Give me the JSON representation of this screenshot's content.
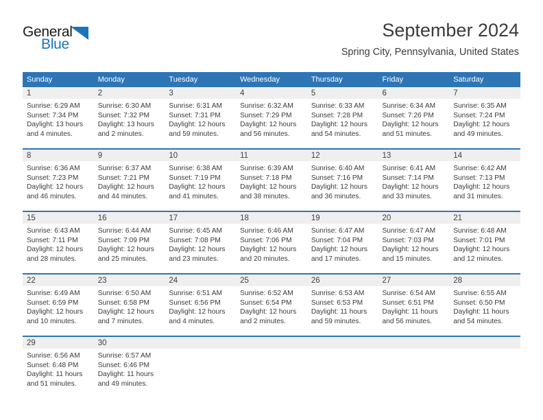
{
  "brand": {
    "name_part1": "General",
    "name_part2": "Blue",
    "triangle_color": "#1c73b8"
  },
  "header": {
    "title": "September 2024",
    "subtitle": "Spring City, Pennsylvania, United States"
  },
  "theme": {
    "header_bg": "#2e75b6",
    "daynum_bg": "#efefef",
    "text": "#3a3a3a"
  },
  "weekday_headers": [
    "Sunday",
    "Monday",
    "Tuesday",
    "Wednesday",
    "Thursday",
    "Friday",
    "Saturday"
  ],
  "weeks": [
    [
      {
        "day": "1",
        "sunrise": "Sunrise: 6:29 AM",
        "sunset": "Sunset: 7:34 PM",
        "daylight_line1": "Daylight: 13 hours",
        "daylight_line2": "and 4 minutes."
      },
      {
        "day": "2",
        "sunrise": "Sunrise: 6:30 AM",
        "sunset": "Sunset: 7:32 PM",
        "daylight_line1": "Daylight: 13 hours",
        "daylight_line2": "and 2 minutes."
      },
      {
        "day": "3",
        "sunrise": "Sunrise: 6:31 AM",
        "sunset": "Sunset: 7:31 PM",
        "daylight_line1": "Daylight: 12 hours",
        "daylight_line2": "and 59 minutes."
      },
      {
        "day": "4",
        "sunrise": "Sunrise: 6:32 AM",
        "sunset": "Sunset: 7:29 PM",
        "daylight_line1": "Daylight: 12 hours",
        "daylight_line2": "and 56 minutes."
      },
      {
        "day": "5",
        "sunrise": "Sunrise: 6:33 AM",
        "sunset": "Sunset: 7:28 PM",
        "daylight_line1": "Daylight: 12 hours",
        "daylight_line2": "and 54 minutes."
      },
      {
        "day": "6",
        "sunrise": "Sunrise: 6:34 AM",
        "sunset": "Sunset: 7:26 PM",
        "daylight_line1": "Daylight: 12 hours",
        "daylight_line2": "and 51 minutes."
      },
      {
        "day": "7",
        "sunrise": "Sunrise: 6:35 AM",
        "sunset": "Sunset: 7:24 PM",
        "daylight_line1": "Daylight: 12 hours",
        "daylight_line2": "and 49 minutes."
      }
    ],
    [
      {
        "day": "8",
        "sunrise": "Sunrise: 6:36 AM",
        "sunset": "Sunset: 7:23 PM",
        "daylight_line1": "Daylight: 12 hours",
        "daylight_line2": "and 46 minutes."
      },
      {
        "day": "9",
        "sunrise": "Sunrise: 6:37 AM",
        "sunset": "Sunset: 7:21 PM",
        "daylight_line1": "Daylight: 12 hours",
        "daylight_line2": "and 44 minutes."
      },
      {
        "day": "10",
        "sunrise": "Sunrise: 6:38 AM",
        "sunset": "Sunset: 7:19 PM",
        "daylight_line1": "Daylight: 12 hours",
        "daylight_line2": "and 41 minutes."
      },
      {
        "day": "11",
        "sunrise": "Sunrise: 6:39 AM",
        "sunset": "Sunset: 7:18 PM",
        "daylight_line1": "Daylight: 12 hours",
        "daylight_line2": "and 38 minutes."
      },
      {
        "day": "12",
        "sunrise": "Sunrise: 6:40 AM",
        "sunset": "Sunset: 7:16 PM",
        "daylight_line1": "Daylight: 12 hours",
        "daylight_line2": "and 36 minutes."
      },
      {
        "day": "13",
        "sunrise": "Sunrise: 6:41 AM",
        "sunset": "Sunset: 7:14 PM",
        "daylight_line1": "Daylight: 12 hours",
        "daylight_line2": "and 33 minutes."
      },
      {
        "day": "14",
        "sunrise": "Sunrise: 6:42 AM",
        "sunset": "Sunset: 7:13 PM",
        "daylight_line1": "Daylight: 12 hours",
        "daylight_line2": "and 31 minutes."
      }
    ],
    [
      {
        "day": "15",
        "sunrise": "Sunrise: 6:43 AM",
        "sunset": "Sunset: 7:11 PM",
        "daylight_line1": "Daylight: 12 hours",
        "daylight_line2": "and 28 minutes."
      },
      {
        "day": "16",
        "sunrise": "Sunrise: 6:44 AM",
        "sunset": "Sunset: 7:09 PM",
        "daylight_line1": "Daylight: 12 hours",
        "daylight_line2": "and 25 minutes."
      },
      {
        "day": "17",
        "sunrise": "Sunrise: 6:45 AM",
        "sunset": "Sunset: 7:08 PM",
        "daylight_line1": "Daylight: 12 hours",
        "daylight_line2": "and 23 minutes."
      },
      {
        "day": "18",
        "sunrise": "Sunrise: 6:46 AM",
        "sunset": "Sunset: 7:06 PM",
        "daylight_line1": "Daylight: 12 hours",
        "daylight_line2": "and 20 minutes."
      },
      {
        "day": "19",
        "sunrise": "Sunrise: 6:47 AM",
        "sunset": "Sunset: 7:04 PM",
        "daylight_line1": "Daylight: 12 hours",
        "daylight_line2": "and 17 minutes."
      },
      {
        "day": "20",
        "sunrise": "Sunrise: 6:47 AM",
        "sunset": "Sunset: 7:03 PM",
        "daylight_line1": "Daylight: 12 hours",
        "daylight_line2": "and 15 minutes."
      },
      {
        "day": "21",
        "sunrise": "Sunrise: 6:48 AM",
        "sunset": "Sunset: 7:01 PM",
        "daylight_line1": "Daylight: 12 hours",
        "daylight_line2": "and 12 minutes."
      }
    ],
    [
      {
        "day": "22",
        "sunrise": "Sunrise: 6:49 AM",
        "sunset": "Sunset: 6:59 PM",
        "daylight_line1": "Daylight: 12 hours",
        "daylight_line2": "and 10 minutes."
      },
      {
        "day": "23",
        "sunrise": "Sunrise: 6:50 AM",
        "sunset": "Sunset: 6:58 PM",
        "daylight_line1": "Daylight: 12 hours",
        "daylight_line2": "and 7 minutes."
      },
      {
        "day": "24",
        "sunrise": "Sunrise: 6:51 AM",
        "sunset": "Sunset: 6:56 PM",
        "daylight_line1": "Daylight: 12 hours",
        "daylight_line2": "and 4 minutes."
      },
      {
        "day": "25",
        "sunrise": "Sunrise: 6:52 AM",
        "sunset": "Sunset: 6:54 PM",
        "daylight_line1": "Daylight: 12 hours",
        "daylight_line2": "and 2 minutes."
      },
      {
        "day": "26",
        "sunrise": "Sunrise: 6:53 AM",
        "sunset": "Sunset: 6:53 PM",
        "daylight_line1": "Daylight: 11 hours",
        "daylight_line2": "and 59 minutes."
      },
      {
        "day": "27",
        "sunrise": "Sunrise: 6:54 AM",
        "sunset": "Sunset: 6:51 PM",
        "daylight_line1": "Daylight: 11 hours",
        "daylight_line2": "and 56 minutes."
      },
      {
        "day": "28",
        "sunrise": "Sunrise: 6:55 AM",
        "sunset": "Sunset: 6:50 PM",
        "daylight_line1": "Daylight: 11 hours",
        "daylight_line2": "and 54 minutes."
      }
    ],
    [
      {
        "day": "29",
        "sunrise": "Sunrise: 6:56 AM",
        "sunset": "Sunset: 6:48 PM",
        "daylight_line1": "Daylight: 11 hours",
        "daylight_line2": "and 51 minutes."
      },
      {
        "day": "30",
        "sunrise": "Sunrise: 6:57 AM",
        "sunset": "Sunset: 6:46 PM",
        "daylight_line1": "Daylight: 11 hours",
        "daylight_line2": "and 49 minutes."
      },
      {
        "day": "",
        "sunrise": "",
        "sunset": "",
        "daylight_line1": "",
        "daylight_line2": ""
      },
      {
        "day": "",
        "sunrise": "",
        "sunset": "",
        "daylight_line1": "",
        "daylight_line2": ""
      },
      {
        "day": "",
        "sunrise": "",
        "sunset": "",
        "daylight_line1": "",
        "daylight_line2": ""
      },
      {
        "day": "",
        "sunrise": "",
        "sunset": "",
        "daylight_line1": "",
        "daylight_line2": ""
      },
      {
        "day": "",
        "sunrise": "",
        "sunset": "",
        "daylight_line1": "",
        "daylight_line2": ""
      }
    ]
  ]
}
